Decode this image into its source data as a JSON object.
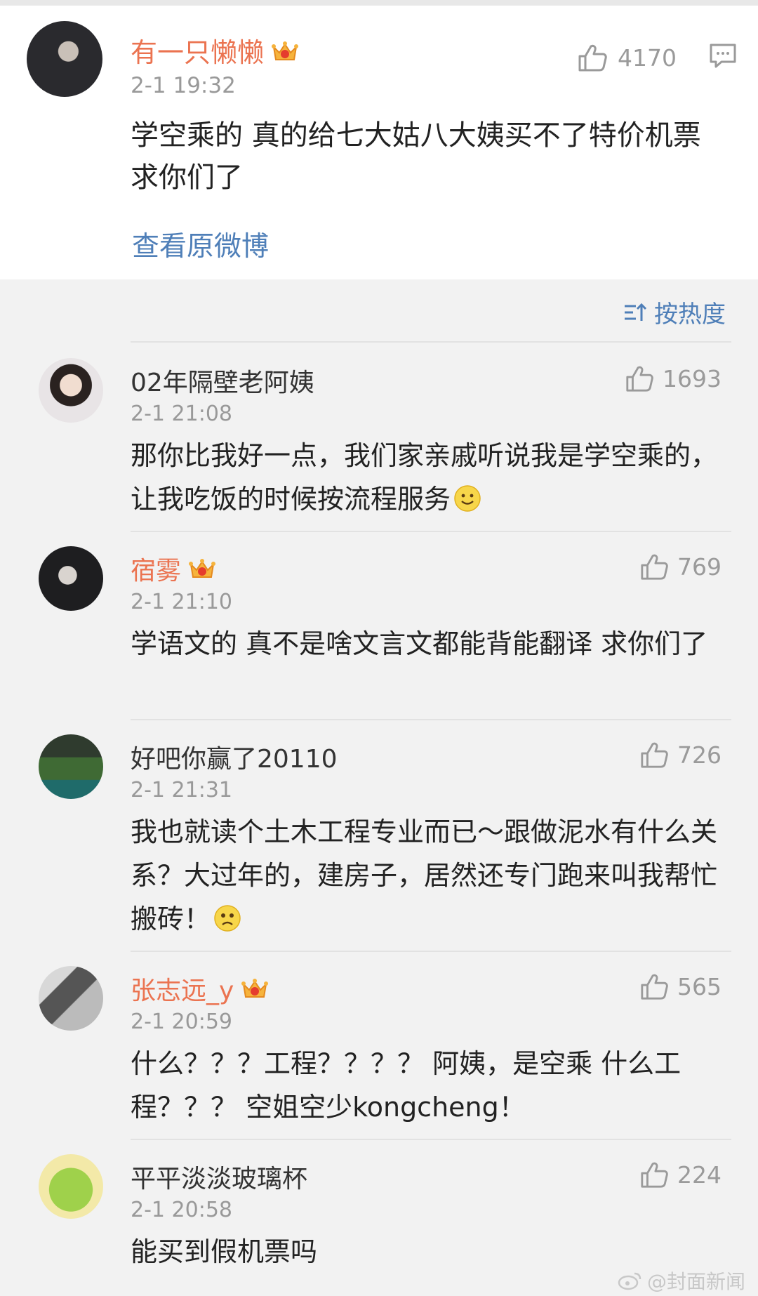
{
  "main_post": {
    "username": "有一只懒懒",
    "time": "2-1 19:32",
    "likes": "4170",
    "text": "学空乘的 真的给七大姑八大姨买不了特价机票 求你们了",
    "view_original": "查看原微博"
  },
  "sort": {
    "label": "按热度"
  },
  "comments": [
    {
      "username": "02年隔壁老阿姨",
      "time": "2-1 21:08",
      "likes": "1693",
      "text": "那你比我好一点，我们家亲戚听说我是学空乘的，让我吃饭的时候按流程服务",
      "vip": false,
      "emoji": "smile"
    },
    {
      "username": "宿雾",
      "time": "2-1 21:10",
      "likes": "769",
      "text": "学语文的 真不是啥文言文都能背能翻译 求你们了",
      "vip": true
    },
    {
      "username": "好吧你赢了20110",
      "time": "2-1 21:31",
      "likes": "726",
      "text": "我也就读个土木工程专业而已～跟做泥水有什么关系？大过年的，建房子，居然还专门跑来叫我帮忙搬砖！",
      "vip": false,
      "emoji": "sad"
    },
    {
      "username": "张志远_y",
      "time": "2-1 20:59",
      "likes": "565",
      "text": "什么？？？工程？？？？ 阿姨，是空乘 什么工程？？？ 空姐空少kongcheng！",
      "vip": true
    },
    {
      "username": "平平淡淡玻璃杯",
      "time": "2-1 20:58",
      "likes": "224",
      "text": "能买到假机票吗",
      "vip": false
    }
  ],
  "watermark": "@封面新闻",
  "colors": {
    "vip_name": "#eb7350",
    "link": "#4f7fb8",
    "meta": "#999999"
  }
}
